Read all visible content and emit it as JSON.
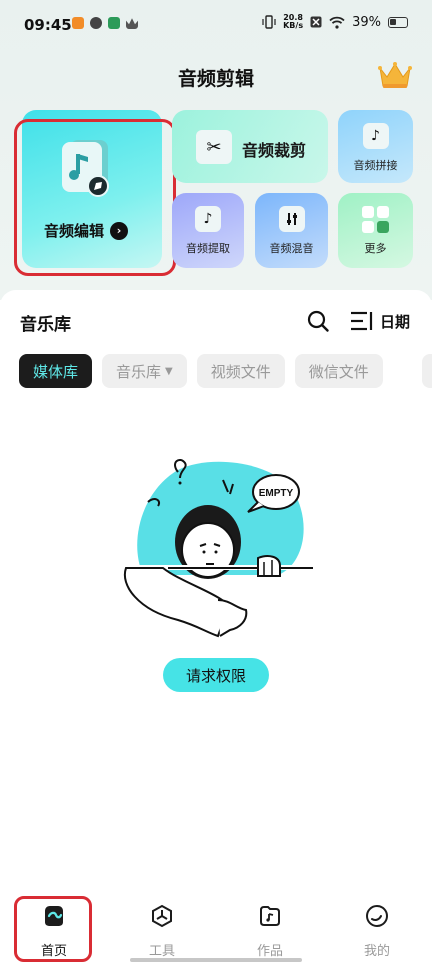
{
  "status_bar": {
    "time": "09:45",
    "net_speed_value": "20.8",
    "net_speed_unit": "KB/s",
    "battery": "39%"
  },
  "header": {
    "title": "音频剪辑"
  },
  "features": {
    "edit": "音频编辑",
    "cut": "音频裁剪",
    "concat": "音频拼接",
    "extract": "音频提取",
    "mix": "音频混音",
    "more": "更多"
  },
  "library": {
    "title": "音乐库",
    "sort_label": "日期",
    "chips": [
      "媒体库",
      "音乐库",
      "视频文件",
      "微信文件"
    ],
    "empty_text": "EMPTY",
    "permission_button": "请求权限"
  },
  "bottom_nav": {
    "items": [
      "首页",
      "工具",
      "作品",
      "我的"
    ],
    "active": "首页"
  },
  "colors": {
    "accent": "#46e3e6",
    "highlight": "#d92c34",
    "active_chip_bg": "#1c1c1c",
    "active_chip_text": "#5fe8e8"
  }
}
